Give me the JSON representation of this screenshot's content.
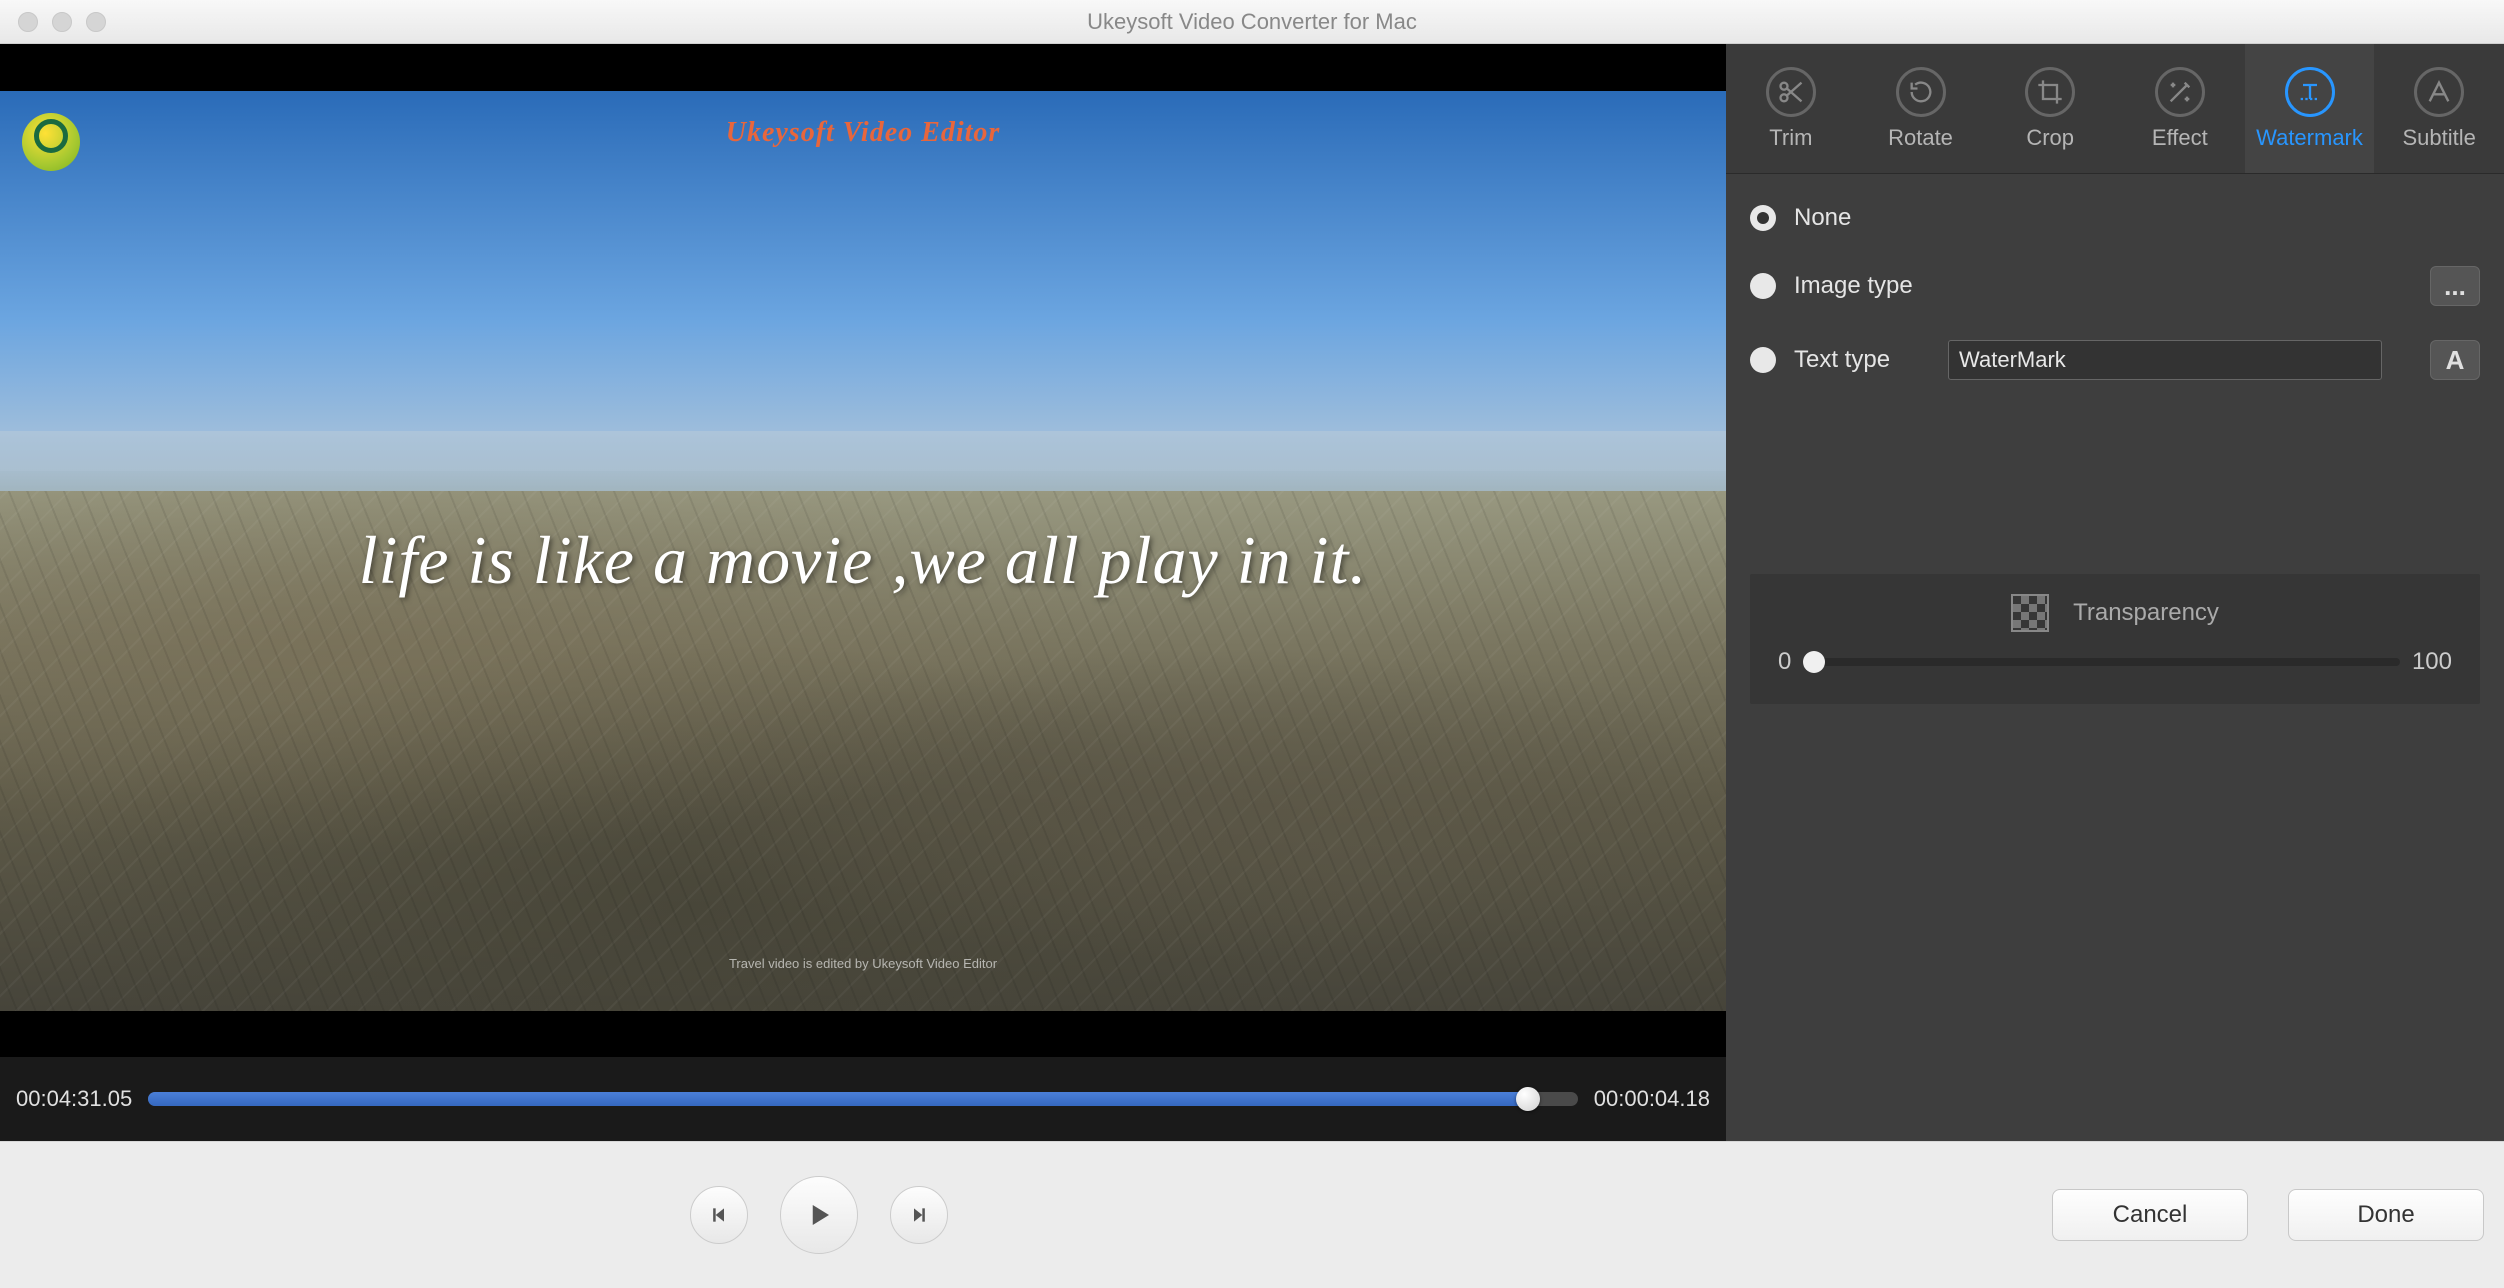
{
  "window": {
    "title": "Ukeysoft Video Converter for Mac"
  },
  "preview": {
    "editor_branding": "Ukeysoft Video Editor",
    "quote": "life is like a movie ,we all play in it.",
    "credit": "Travel video is edited by Ukeysoft Video Editor"
  },
  "timeline": {
    "current_time": "00:04:31.05",
    "duration_label": "00:00:04.18"
  },
  "tabs": {
    "trim": "Trim",
    "rotate": "Rotate",
    "crop": "Crop",
    "effect": "Effect",
    "watermark": "Watermark",
    "subtitle": "Subtitle"
  },
  "watermark": {
    "none_label": "None",
    "image_label": "Image type",
    "text_label": "Text type",
    "text_value": "WaterMark",
    "browse_label": "...",
    "font_btn_label": "A",
    "transparency_label": "Transparency",
    "slider_min": "0",
    "slider_max": "100"
  },
  "actions": {
    "cancel": "Cancel",
    "done": "Done"
  }
}
